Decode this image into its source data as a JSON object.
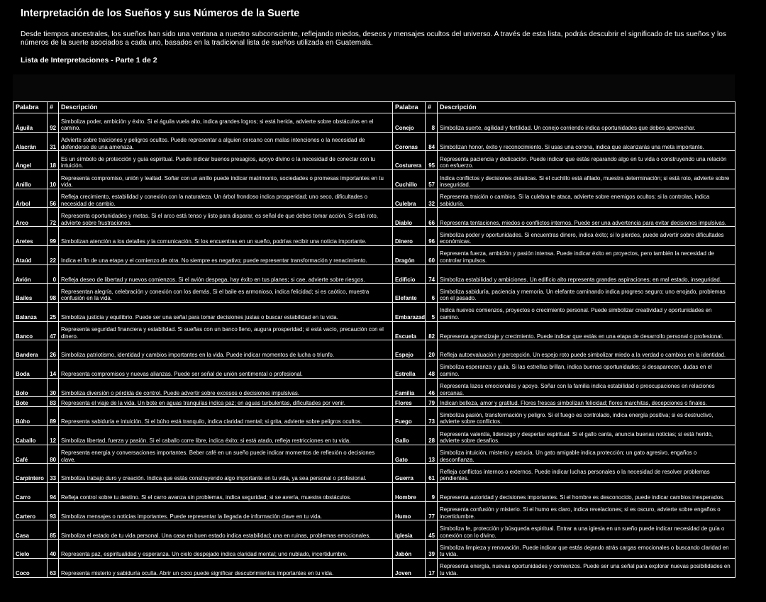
{
  "title": "Interpretación de los Sueños y sus Números de la Suerte",
  "intro": "Desde tiempos ancestrales, los sueños han sido una ventana a nuestro subconsciente, reflejando miedos, deseos y mensajes ocultos del universo. A través de esta lista, podrás descubrir el significado de tus sueños y los números de la suerte asociados a cada uno, basados en la tradicional lista de sueños utilizada en Guatemala.",
  "subtitle": "Lista de Interpretaciones - Parte 1 de 2",
  "table": {
    "headers": [
      "Palabra",
      "#",
      "Descripción",
      "Palabra",
      "#",
      "Descripción"
    ],
    "rows": [
      {
        "w1": "Águila",
        "n1": "92",
        "d1": "Simboliza poder, ambición y éxito. Si el águila vuela alto, indica grandes logros; si está herida, advierte sobre obstáculos en el camino.",
        "w2": "Conejo",
        "n2": "8",
        "d2": "Simboliza suerte, agilidad y fertilidad. Un conejo corriendo indica oportunidades que debes aprovechar."
      },
      {
        "w1": "Alacrán",
        "n1": "31",
        "d1": "Advierte sobre traiciones y peligros ocultos. Puede representar a alguien cercano con malas intenciones o la necesidad de defenderse de una amenaza.",
        "w2": "Coronas",
        "n2": "84",
        "d2": "Simbolizan honor, éxito y reconocimiento. Si usas una corona, indica que alcanzarás una meta importante."
      },
      {
        "w1": "Ángel",
        "n1": "18",
        "d1": "Es un símbolo de protección y guía espiritual. Puede indicar buenos presagios, apoyo divino o la necesidad de conectar con tu intuición.",
        "w2": "Costurera",
        "n2": "95",
        "d2": "Representa paciencia y dedicación. Puede indicar que estás reparando algo en tu vida o construyendo una relación con esfuerzo."
      },
      {
        "w1": "Anillo",
        "n1": "10",
        "d1": "Representa compromiso, unión y lealtad. Soñar con un anillo puede indicar matrimonio, sociedades o promesas importantes en tu vida.",
        "w2": "Cuchillo",
        "n2": "57",
        "d2": "Indica conflictos y decisiones drásticas. Si el cuchillo está afilado, muestra determinación; si está roto, advierte sobre inseguridad."
      },
      {
        "w1": "Árbol",
        "n1": "56",
        "d1": "Refleja crecimiento, estabilidad y conexión con la naturaleza. Un árbol frondoso indica prosperidad; uno seco, dificultades o necesidad de cambio.",
        "w2": "Culebra",
        "n2": "32",
        "d2": "Representa traición o cambios. Si la culebra te ataca, advierte sobre enemigos ocultos; si la controlas, indica sabiduría."
      },
      {
        "w1": "Arco",
        "n1": "72",
        "d1": "Representa oportunidades y metas. Si el arco está tenso y listo para disparar, es señal de que debes tomar acción. Si está roto, advierte sobre frustraciones.",
        "w2": "Diablo",
        "n2": "66",
        "d2": "Representa tentaciones, miedos o conflictos internos. Puede ser una advertencia para evitar decisiones impulsivas."
      },
      {
        "w1": "Aretes",
        "n1": "99",
        "d1": "Simbolizan atención a los detalles y la comunicación. Si los encuentras en un sueño, podrías recibir una noticia importante.",
        "w2": "Dinero",
        "n2": "96",
        "d2": "Simboliza poder y oportunidades. Si encuentras dinero, indica éxito; si lo pierdes, puede advertir sobre dificultades económicas."
      },
      {
        "w1": "Ataúd",
        "n1": "22",
        "d1": "Indica el fin de una etapa y el comienzo de otra. No siempre es negativo; puede representar transformación y renacimiento.",
        "w2": "Dragón",
        "n2": "60",
        "d2": "Representa fuerza, ambición y pasión intensa. Puede indicar éxito en proyectos, pero también la necesidad de controlar impulsos."
      },
      {
        "w1": "Avión",
        "n1": "0",
        "d1": "Refleja deseo de libertad y nuevos comienzos. Si el avión despega, hay éxito en tus planes; si cae, advierte sobre riesgos.",
        "w2": "Edificio",
        "n2": "74",
        "d2": "Simboliza estabilidad y ambiciones. Un edificio alto representa grandes aspiraciones; en mal estado, inseguridad."
      },
      {
        "w1": "Bailes",
        "n1": "98",
        "d1": "Representan alegría, celebración y conexión con los demás. Si el baile es armonioso, indica felicidad; si es caótico, muestra confusión en la vida.",
        "w2": "Elefante",
        "n2": "6",
        "d2": "Simboliza sabiduría, paciencia y memoria. Un elefante caminando indica progreso seguro; uno enojado, problemas con el pasado."
      },
      {
        "w1": "Balanza",
        "n1": "25",
        "d1": "Simboliza justicia y equilibrio. Puede ser una señal para tomar decisiones justas o buscar estabilidad en tu vida.",
        "w2": "Embarazada",
        "n2": "5",
        "d2": "Indica nuevos comienzos, proyectos o crecimiento personal. Puede simbolizar creatividad y oportunidades en camino."
      },
      {
        "w1": "Banco",
        "n1": "47",
        "d1": "Representa seguridad financiera y estabilidad. Si sueñas con un banco lleno, augura prosperidad; si está vacío, precaución con el dinero.",
        "w2": "Escuela",
        "n2": "82",
        "d2": "Representa aprendizaje y crecimiento. Puede indicar que estás en una etapa de desarrollo personal o profesional."
      },
      {
        "w1": "Bandera",
        "n1": "26",
        "d1": "Simboliza patriotismo, identidad y cambios importantes en la vida. Puede indicar momentos de lucha o triunfo.",
        "w2": "Espejo",
        "n2": "20",
        "d2": "Refleja autoevaluación y percepción. Un espejo roto puede simbolizar miedo a la verdad o cambios en la identidad."
      },
      {
        "w1": "Boda",
        "n1": "14",
        "d1": "Representa compromisos y nuevas alianzas. Puede ser señal de unión sentimental o profesional.",
        "w2": "Estrella",
        "n2": "48",
        "d2": "Simboliza esperanza y guía. Si las estrellas brillan, indica buenas oportunidades; si desaparecen, dudas en el camino."
      },
      {
        "w1": "Bolo",
        "n1": "30",
        "d1": "Simboliza diversión o pérdida de control. Puede advertir sobre excesos o decisiones impulsivas.",
        "w2": "Familia",
        "n2": "46",
        "d2": "Representa lazos emocionales y apoyo. Soñar con la familia indica estabilidad o preocupaciones en relaciones cercanas."
      },
      {
        "w1": "Bote",
        "n1": "83",
        "d1": "Representa el viaje de la vida. Un bote en aguas tranquilas indica paz; en aguas turbulentas, dificultades por venir.",
        "w2": "Flores",
        "n2": "79",
        "d2": "Indican belleza, amor y gratitud. Flores frescas simbolizan felicidad; flores marchitas, decepciones o finales."
      },
      {
        "w1": "Búho",
        "n1": "89",
        "d1": "Representa sabiduría e intuición. Si el búho está tranquilo, indica claridad mental; si grita, advierte sobre peligros ocultos.",
        "w2": "Fuego",
        "n2": "73",
        "d2": "Simboliza pasión, transformación y peligro. Si el fuego es controlado, indica energía positiva; si es destructivo, advierte sobre conflictos."
      },
      {
        "w1": "Caballo",
        "n1": "12",
        "d1": "Simboliza libertad, fuerza y pasión. Si el caballo corre libre, indica éxito; si está atado, refleja restricciones en tu vida.",
        "w2": "Gallo",
        "n2": "28",
        "d2": "Representa valentía, liderazgo y despertar espiritual. Si el gallo canta, anuncia buenas noticias; si está herido, advierte sobre desafíos."
      },
      {
        "w1": "Café",
        "n1": "80",
        "d1": "Representa energía y conversaciones importantes. Beber café en un sueño puede indicar momentos de reflexión o decisiones clave.",
        "w2": "Gato",
        "n2": "13",
        "d2": "Simboliza intuición, misterio y astucia. Un gato amigable indica protección; un gato agresivo, engaños o desconfianza."
      },
      {
        "w1": "Carpintero",
        "n1": "33",
        "d1": "Simboliza trabajo duro y creación. Indica que estás construyendo algo importante en tu vida, ya sea personal o profesional.",
        "w2": "Guerra",
        "n2": "61",
        "d2": "Refleja conflictos internos o externos. Puede indicar luchas personales o la necesidad de resolver problemas pendientes."
      },
      {
        "w1": "Carro",
        "n1": "94",
        "d1": "Refleja control sobre tu destino. Si el carro avanza sin problemas, indica seguridad; si se avería, muestra obstáculos.",
        "w2": "Hombre",
        "n2": "9",
        "d2": "Representa autoridad y decisiones importantes. Si el hombre es desconocido, puede indicar cambios inesperados."
      },
      {
        "w1": "Cartero",
        "n1": "93",
        "d1": "Simboliza mensajes o noticias importantes. Puede representar la llegada de información clave en tu vida.",
        "w2": "Humo",
        "n2": "77",
        "d2": "Representa confusión y misterio. Si el humo es claro, indica revelaciones; si es oscuro, advierte sobre engaños o incertidumbre."
      },
      {
        "w1": "Casa",
        "n1": "85",
        "d1": "Simboliza el estado de tu vida personal. Una casa en buen estado indica estabilidad; una en ruinas, problemas emocionales.",
        "w2": "Iglesia",
        "n2": "45",
        "d2": "Simboliza fe, protección y búsqueda espiritual. Entrar a una iglesia en un sueño puede indicar necesidad de guía o conexión con lo divino."
      },
      {
        "w1": "Cielo",
        "n1": "40",
        "d1": "Representa paz, espiritualidad y esperanza. Un cielo despejado indica claridad mental; uno nublado, incertidumbre.",
        "w2": "Jabón",
        "n2": "39",
        "d2": "Simboliza limpieza y renovación. Puede indicar que estás dejando atrás cargas emocionales o buscando claridad en tu vida."
      },
      {
        "w1": "Coco",
        "n1": "63",
        "d1": "Representa misterio y sabiduría oculta. Abrir un coco puede significar descubrimientos importantes en tu vida.",
        "w2": "Joven",
        "n2": "17",
        "d2": "Representa energía, nuevas oportunidades y comienzos. Puede ser una señal para explorar nuevas posibilidades en tu vida."
      }
    ]
  }
}
